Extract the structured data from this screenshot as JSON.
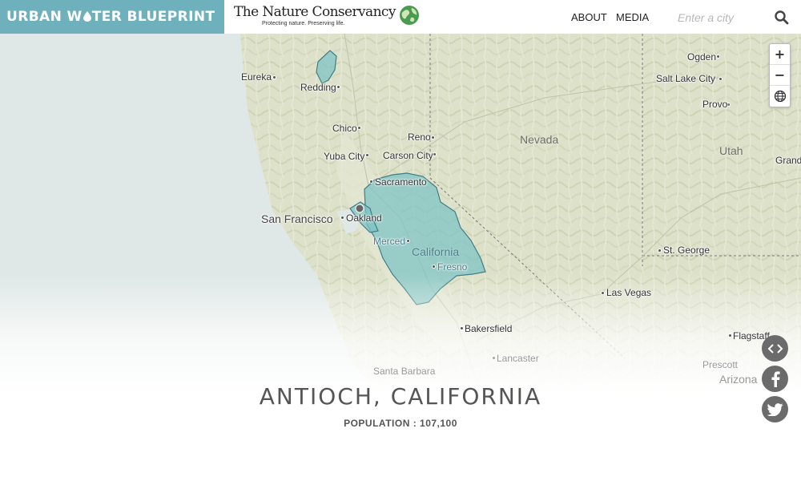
{
  "header": {
    "brand_left": "URBAN W",
    "brand_right": "TER BLUEPRINT",
    "tnc_name": "The Nature Conservancy",
    "tnc_tagline": "Protecting nature. Preserving life.",
    "nav": {
      "about": "ABOUT",
      "media": "MEDIA"
    },
    "search": {
      "placeholder": "Enter a city",
      "value": ""
    },
    "brand_color": "#6fb0bd"
  },
  "map": {
    "labels": {
      "ogden": "Ogden",
      "salt_lake_city": "Salt Lake City",
      "provo": "Provo",
      "eureka": "Eureka",
      "redding": "Redding",
      "chico": "Chico",
      "reno": "Reno",
      "yuba_city": "Yuba City",
      "carson_city": "Carson City",
      "nevada": "Nevada",
      "utah": "Utah",
      "grand": "Grand",
      "sacramento": "Sacramento",
      "san_francisco": "San Francisco",
      "oakland": "Oakland",
      "merced": "Merced",
      "california": "California",
      "fresno": "Fresno",
      "st_george": "St. George",
      "las_vegas": "Las Vegas",
      "bakersfield": "Bakersfield",
      "flagstaff": "Flagstaff",
      "lancaster": "Lancaster",
      "santa_barbara": "Santa Barbara",
      "prescott": "Prescott",
      "arizona": "Arizona"
    },
    "zoom": {
      "in": "+",
      "out": "−"
    },
    "colors": {
      "watershed": "#7fc3c4",
      "land": "#dfe3cc",
      "ocean": "#dfe8e6"
    },
    "icons": [
      "plus-icon",
      "minus-icon",
      "globe-icon",
      "embed-icon",
      "facebook-icon",
      "twitter-icon",
      "search-icon",
      "water-drop-icon"
    ]
  },
  "city": {
    "name": "ANTIOCH, CALIFORNIA",
    "population": "POPULATION : 107,100"
  }
}
